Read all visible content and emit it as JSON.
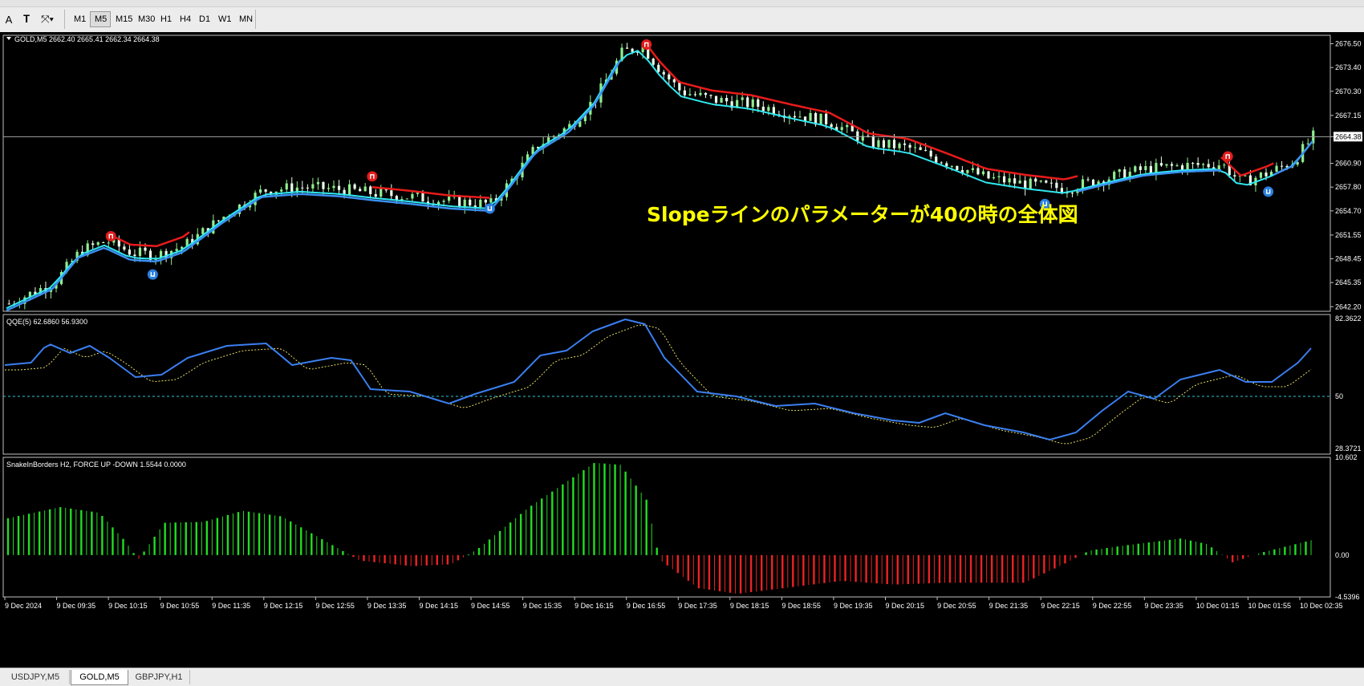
{
  "toolbar": {
    "timeframes": [
      "M1",
      "M5",
      "M15",
      "M30",
      "H1",
      "H4",
      "D1",
      "W1",
      "MN"
    ],
    "active_timeframe": "M5",
    "text_tool": "A"
  },
  "main_panel": {
    "header": "GOLD,M5  2662.40 2665.41 2662.34 2664.38",
    "price_labels": [
      "2676.50",
      "2673.40",
      "2670.30",
      "2667.15",
      "2664.38",
      "2660.90",
      "2657.80",
      "2654.70",
      "2651.55",
      "2648.45",
      "2645.35",
      "2642.20"
    ],
    "annotation": "Slopeラインのパラメーターが40の時の全体図",
    "colors": {
      "up_line": "#3b8ff0",
      "down_line": "#e81b1b",
      "fast_line": "#30e8f0",
      "candle_up": "#90ee90",
      "candle_down": "#e8ffe8",
      "arrow_up": "#2a7fe0",
      "arrow_down": "#e01c1c"
    }
  },
  "qqe_panel": {
    "header": "QQE(5) 62.6860 56.9300",
    "axis_labels": [
      "82.3622",
      "50",
      "28.3721"
    ],
    "colors": {
      "main": "#3b7ff0",
      "signal": "#e8e060",
      "level": "#30c8d8"
    }
  },
  "snake_panel": {
    "header": "SnakeInBorders H2, FORCE UP -DOWN  1.5544 0.0000",
    "axis_labels": [
      "10.602",
      "0.00",
      "-4.5396"
    ],
    "colors": {
      "up": "#22dd22",
      "down": "#ee2222"
    }
  },
  "time_axis": [
    "9 Dec 2024",
    "9 Dec 09:35",
    "9 Dec 10:15",
    "9 Dec 10:55",
    "9 Dec 11:35",
    "9 Dec 12:15",
    "9 Dec 12:55",
    "9 Dec 13:35",
    "9 Dec 14:15",
    "9 Dec 14:55",
    "9 Dec 15:35",
    "9 Dec 16:15",
    "9 Dec 16:55",
    "9 Dec 17:35",
    "9 Dec 18:15",
    "9 Dec 18:55",
    "9 Dec 19:35",
    "9 Dec 20:15",
    "9 Dec 20:55",
    "9 Dec 21:35",
    "9 Dec 22:15",
    "9 Dec 22:55",
    "9 Dec 23:35",
    "10 Dec 01:15",
    "10 Dec 01:55",
    "10 Dec 02:35"
  ],
  "tabs": [
    {
      "label": "USDJPY,M5",
      "active": false
    },
    {
      "label": "GOLD,M5",
      "active": true
    },
    {
      "label": "GBPJPY,H1",
      "active": false
    }
  ]
}
